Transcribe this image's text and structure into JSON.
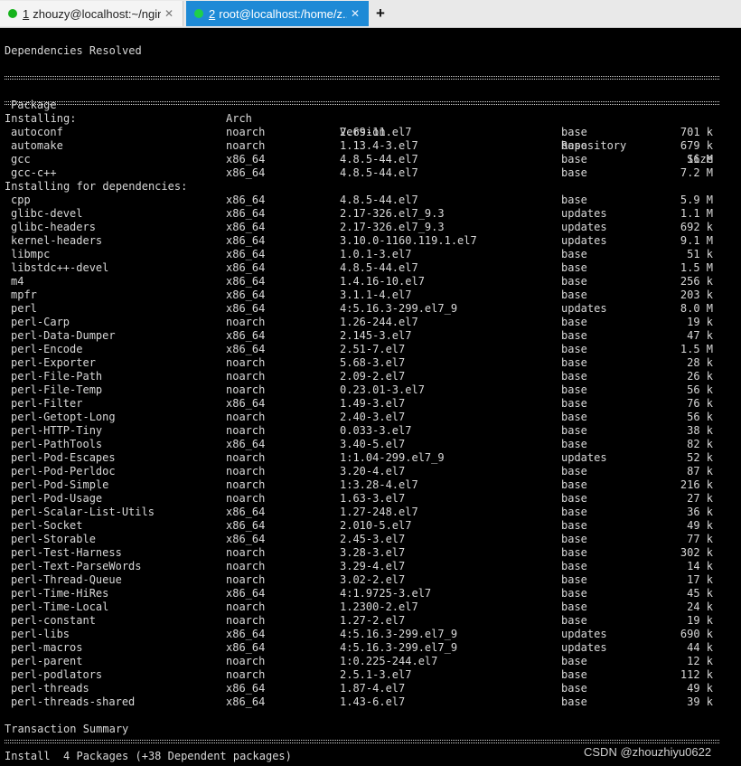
{
  "tabs": [
    {
      "number": "1",
      "title": "zhouzy@localhost:~/ngin...",
      "close": "✕"
    },
    {
      "number": "2",
      "title": "root@localhost:/home/z...",
      "close": "✕"
    }
  ],
  "add_tab": "+",
  "terminal": {
    "resolved": "Dependencies Resolved",
    "headers": {
      "package": "Package",
      "arch": "Arch",
      "version": "Version",
      "repository": "Repository",
      "size": "Size"
    },
    "installing_label": "Installing:",
    "deps_label": "Installing for dependencies:",
    "installing": [
      {
        "name": "autoconf",
        "arch": "noarch",
        "version": "2.69-11.el7",
        "repo": "base",
        "size": "701 k"
      },
      {
        "name": "automake",
        "arch": "noarch",
        "version": "1.13.4-3.el7",
        "repo": "base",
        "size": "679 k"
      },
      {
        "name": "gcc",
        "arch": "x86_64",
        "version": "4.8.5-44.el7",
        "repo": "base",
        "size": "16 M"
      },
      {
        "name": "gcc-c++",
        "arch": "x86_64",
        "version": "4.8.5-44.el7",
        "repo": "base",
        "size": "7.2 M"
      }
    ],
    "dependencies": [
      {
        "name": "cpp",
        "arch": "x86_64",
        "version": "4.8.5-44.el7",
        "repo": "base",
        "size": "5.9 M"
      },
      {
        "name": "glibc-devel",
        "arch": "x86_64",
        "version": "2.17-326.el7_9.3",
        "repo": "updates",
        "size": "1.1 M"
      },
      {
        "name": "glibc-headers",
        "arch": "x86_64",
        "version": "2.17-326.el7_9.3",
        "repo": "updates",
        "size": "692 k"
      },
      {
        "name": "kernel-headers",
        "arch": "x86_64",
        "version": "3.10.0-1160.119.1.el7",
        "repo": "updates",
        "size": "9.1 M"
      },
      {
        "name": "libmpc",
        "arch": "x86_64",
        "version": "1.0.1-3.el7",
        "repo": "base",
        "size": "51 k"
      },
      {
        "name": "libstdc++-devel",
        "arch": "x86_64",
        "version": "4.8.5-44.el7",
        "repo": "base",
        "size": "1.5 M"
      },
      {
        "name": "m4",
        "arch": "x86_64",
        "version": "1.4.16-10.el7",
        "repo": "base",
        "size": "256 k"
      },
      {
        "name": "mpfr",
        "arch": "x86_64",
        "version": "3.1.1-4.el7",
        "repo": "base",
        "size": "203 k"
      },
      {
        "name": "perl",
        "arch": "x86_64",
        "version": "4:5.16.3-299.el7_9",
        "repo": "updates",
        "size": "8.0 M"
      },
      {
        "name": "perl-Carp",
        "arch": "noarch",
        "version": "1.26-244.el7",
        "repo": "base",
        "size": "19 k"
      },
      {
        "name": "perl-Data-Dumper",
        "arch": "x86_64",
        "version": "2.145-3.el7",
        "repo": "base",
        "size": "47 k"
      },
      {
        "name": "perl-Encode",
        "arch": "x86_64",
        "version": "2.51-7.el7",
        "repo": "base",
        "size": "1.5 M"
      },
      {
        "name": "perl-Exporter",
        "arch": "noarch",
        "version": "5.68-3.el7",
        "repo": "base",
        "size": "28 k"
      },
      {
        "name": "perl-File-Path",
        "arch": "noarch",
        "version": "2.09-2.el7",
        "repo": "base",
        "size": "26 k"
      },
      {
        "name": "perl-File-Temp",
        "arch": "noarch",
        "version": "0.23.01-3.el7",
        "repo": "base",
        "size": "56 k"
      },
      {
        "name": "perl-Filter",
        "arch": "x86_64",
        "version": "1.49-3.el7",
        "repo": "base",
        "size": "76 k"
      },
      {
        "name": "perl-Getopt-Long",
        "arch": "noarch",
        "version": "2.40-3.el7",
        "repo": "base",
        "size": "56 k"
      },
      {
        "name": "perl-HTTP-Tiny",
        "arch": "noarch",
        "version": "0.033-3.el7",
        "repo": "base",
        "size": "38 k"
      },
      {
        "name": "perl-PathTools",
        "arch": "x86_64",
        "version": "3.40-5.el7",
        "repo": "base",
        "size": "82 k"
      },
      {
        "name": "perl-Pod-Escapes",
        "arch": "noarch",
        "version": "1:1.04-299.el7_9",
        "repo": "updates",
        "size": "52 k"
      },
      {
        "name": "perl-Pod-Perldoc",
        "arch": "noarch",
        "version": "3.20-4.el7",
        "repo": "base",
        "size": "87 k"
      },
      {
        "name": "perl-Pod-Simple",
        "arch": "noarch",
        "version": "1:3.28-4.el7",
        "repo": "base",
        "size": "216 k"
      },
      {
        "name": "perl-Pod-Usage",
        "arch": "noarch",
        "version": "1.63-3.el7",
        "repo": "base",
        "size": "27 k"
      },
      {
        "name": "perl-Scalar-List-Utils",
        "arch": "x86_64",
        "version": "1.27-248.el7",
        "repo": "base",
        "size": "36 k"
      },
      {
        "name": "perl-Socket",
        "arch": "x86_64",
        "version": "2.010-5.el7",
        "repo": "base",
        "size": "49 k"
      },
      {
        "name": "perl-Storable",
        "arch": "x86_64",
        "version": "2.45-3.el7",
        "repo": "base",
        "size": "77 k"
      },
      {
        "name": "perl-Test-Harness",
        "arch": "noarch",
        "version": "3.28-3.el7",
        "repo": "base",
        "size": "302 k"
      },
      {
        "name": "perl-Text-ParseWords",
        "arch": "noarch",
        "version": "3.29-4.el7",
        "repo": "base",
        "size": "14 k"
      },
      {
        "name": "perl-Thread-Queue",
        "arch": "noarch",
        "version": "3.02-2.el7",
        "repo": "base",
        "size": "17 k"
      },
      {
        "name": "perl-Time-HiRes",
        "arch": "x86_64",
        "version": "4:1.9725-3.el7",
        "repo": "base",
        "size": "45 k"
      },
      {
        "name": "perl-Time-Local",
        "arch": "noarch",
        "version": "1.2300-2.el7",
        "repo": "base",
        "size": "24 k"
      },
      {
        "name": "perl-constant",
        "arch": "noarch",
        "version": "1.27-2.el7",
        "repo": "base",
        "size": "19 k"
      },
      {
        "name": "perl-libs",
        "arch": "x86_64",
        "version": "4:5.16.3-299.el7_9",
        "repo": "updates",
        "size": "690 k"
      },
      {
        "name": "perl-macros",
        "arch": "x86_64",
        "version": "4:5.16.3-299.el7_9",
        "repo": "updates",
        "size": "44 k"
      },
      {
        "name": "perl-parent",
        "arch": "noarch",
        "version": "1:0.225-244.el7",
        "repo": "base",
        "size": "12 k"
      },
      {
        "name": "perl-podlators",
        "arch": "noarch",
        "version": "2.5.1-3.el7",
        "repo": "base",
        "size": "112 k"
      },
      {
        "name": "perl-threads",
        "arch": "x86_64",
        "version": "1.87-4.el7",
        "repo": "base",
        "size": "49 k"
      },
      {
        "name": "perl-threads-shared",
        "arch": "x86_64",
        "version": "1.43-6.el7",
        "repo": "base",
        "size": "39 k"
      }
    ],
    "summary_label": "Transaction Summary",
    "install_line": "Install  4 Packages (+38 Dependent packages)"
  },
  "watermark": "CSDN @zhouzhiyu0622"
}
